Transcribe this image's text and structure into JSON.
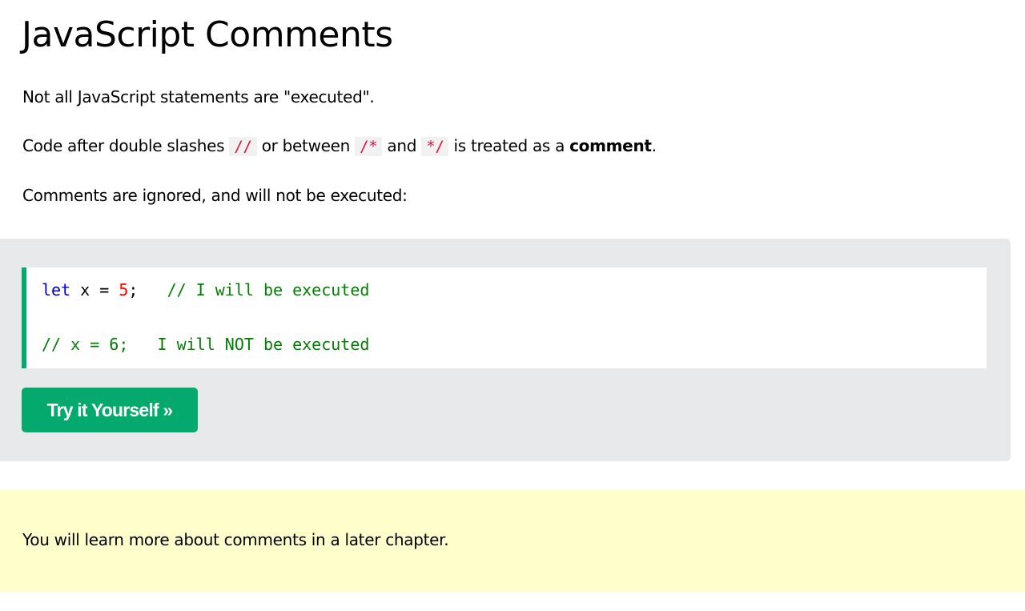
{
  "title": "JavaScript Comments",
  "p1": "Not all JavaScript statements are \"executed\".",
  "p2": {
    "before": "Code after double slashes ",
    "c1": "//",
    "mid1": " or between ",
    "c2": "/*",
    "mid2": " and ",
    "c3": "*/",
    "mid3": " is treated as a ",
    "bold": "comment",
    "end": "."
  },
  "p3": "Comments are ignored, and will not be executed:",
  "code": {
    "l1_kw": "let",
    "l1_a": " x = ",
    "l1_num": "5",
    "l1_b": ";   ",
    "l1_cm": "// I will be executed",
    "l2": "// x = 6;   I will NOT be executed"
  },
  "button": "Try it Yourself »",
  "note": "You will learn more about comments in a later chapter."
}
